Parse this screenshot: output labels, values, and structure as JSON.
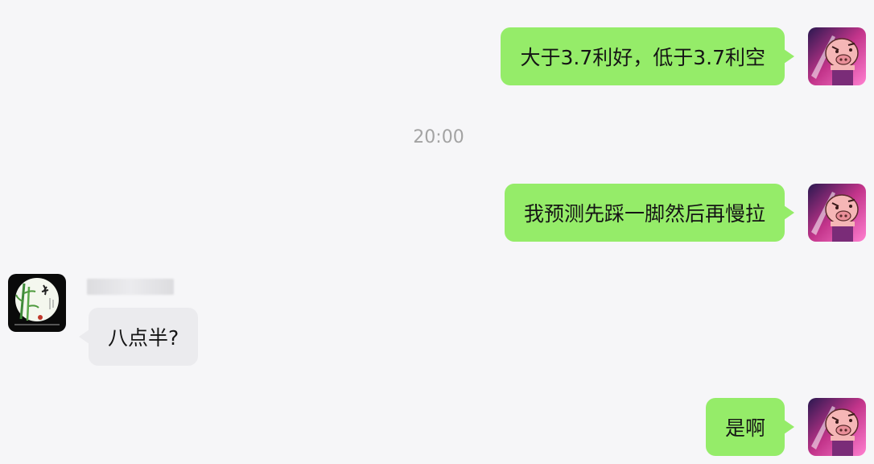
{
  "messages": [
    {
      "direction": "outgoing",
      "text": "大于3.7利好，低于3.7利空"
    },
    {
      "direction": "timestamp",
      "text": "20:00"
    },
    {
      "direction": "outgoing",
      "text": "我预测先踩一脚然后再慢拉"
    },
    {
      "direction": "incoming",
      "text": "八点半?"
    },
    {
      "direction": "outgoing",
      "text": "是啊"
    }
  ],
  "colors": {
    "background": "#f6f6f8",
    "outgoing_bubble": "#95ec69",
    "incoming_bubble": "#ebebee",
    "timestamp_text": "#a3a3a3"
  },
  "icons": {
    "self_avatar": "cartoon-pig-avatar-icon",
    "other_avatar": "bamboo-ink-avatar-icon"
  }
}
